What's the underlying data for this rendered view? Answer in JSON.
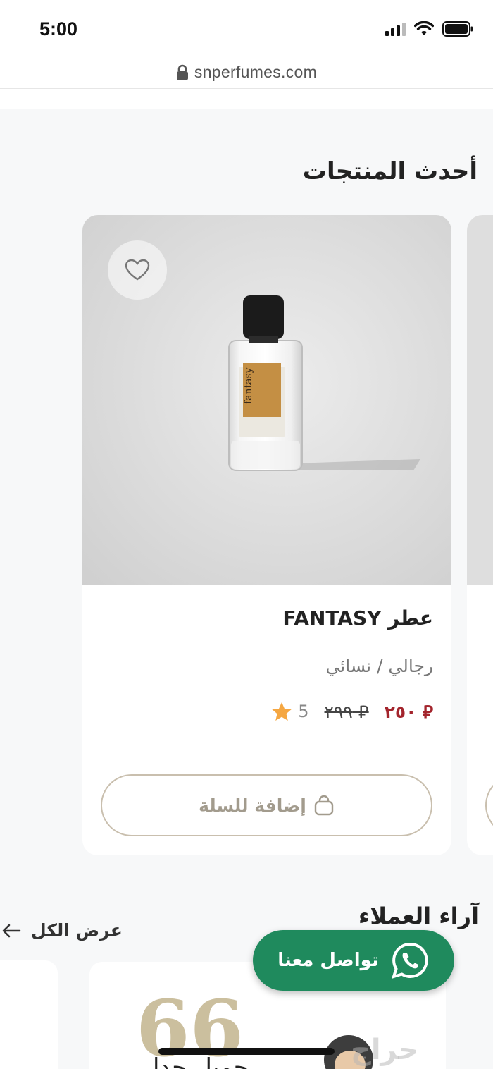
{
  "status_bar": {
    "time": "5:00"
  },
  "browser": {
    "url": "snperfumes.com"
  },
  "section": {
    "title": "أحدث المنتجات"
  },
  "product": {
    "name": "عطر FANTASY",
    "category": "رجالي / نسائي",
    "price_new": "٢٥٠",
    "price_old": "٢٩٩",
    "currency_symbol": "⃁",
    "rating": "5",
    "add_to_cart_label": "إضافة للسلة",
    "bottle_label": "fantasy"
  },
  "reviews": {
    "title": "آراء العملاء",
    "view_all_label": "عرض الكل",
    "quote_symbol": "66",
    "review_text": "جميل جدا"
  },
  "whatsapp": {
    "label": "تواصل معنا"
  },
  "watermark": "حراج",
  "colors": {
    "price_accent": "#a3242c",
    "whatsapp_green": "#1f8a5d",
    "gold_outline": "#c9bfae",
    "star": "#f5a742"
  },
  "icons": [
    "lock-icon",
    "heart-icon",
    "star-icon",
    "bag-icon",
    "arrow-left-icon",
    "whatsapp-icon",
    "signal-icon",
    "wifi-icon",
    "battery-icon"
  ]
}
